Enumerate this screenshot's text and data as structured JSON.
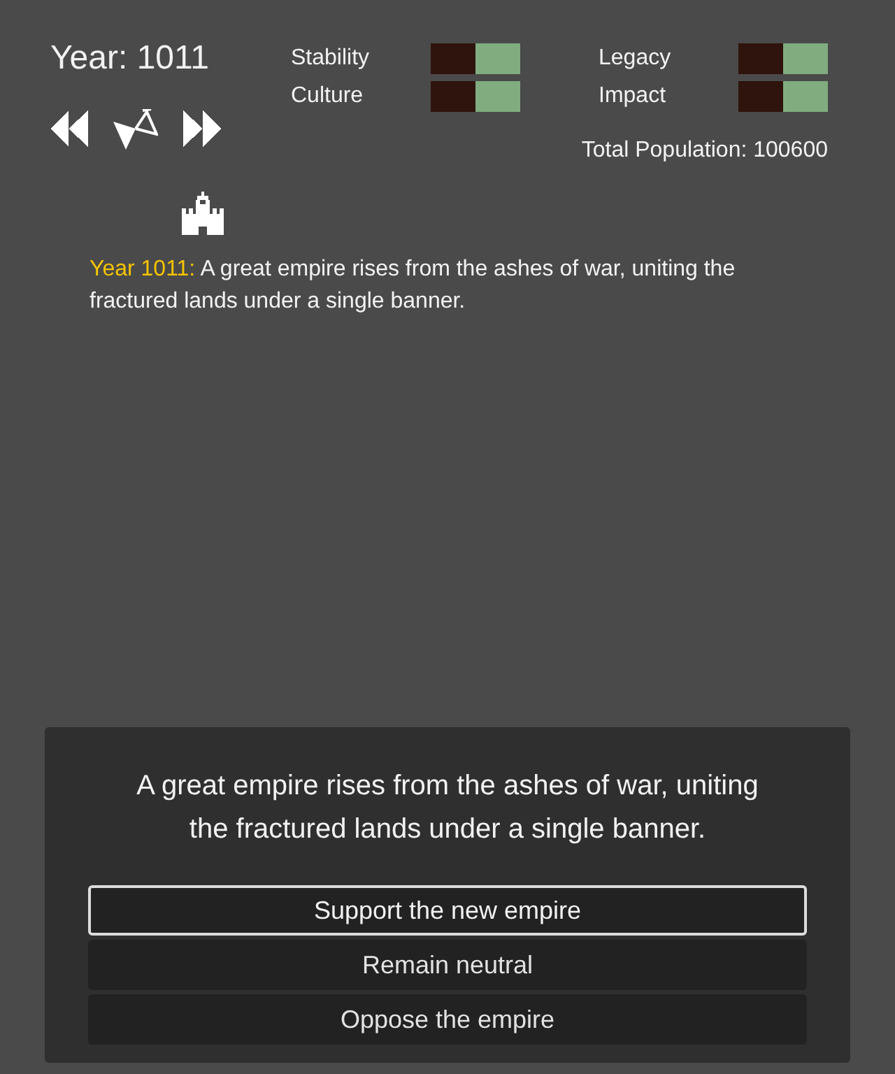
{
  "header": {
    "year": "Year: 1011"
  },
  "stats": [
    {
      "label": "Stability",
      "level": 0.5
    },
    {
      "label": "Legacy",
      "level": 0.5
    },
    {
      "label": "Culture",
      "level": 0.5
    },
    {
      "label": "Impact",
      "level": 0.5
    }
  ],
  "population": "Total Population: 100600",
  "event_log": [
    {
      "date": "Year 1011:",
      "text": "A great empire rises from the ashes of war, uniting the fractured lands under a single banner."
    }
  ],
  "dialog": {
    "text": "A great empire rises from the ashes of war, uniting the fractured lands under a single banner.",
    "choices": [
      {
        "label": "Support the new empire",
        "selected": true
      },
      {
        "label": "Remain neutral",
        "selected": false
      },
      {
        "label": "Oppose the empire",
        "selected": false
      }
    ]
  }
}
